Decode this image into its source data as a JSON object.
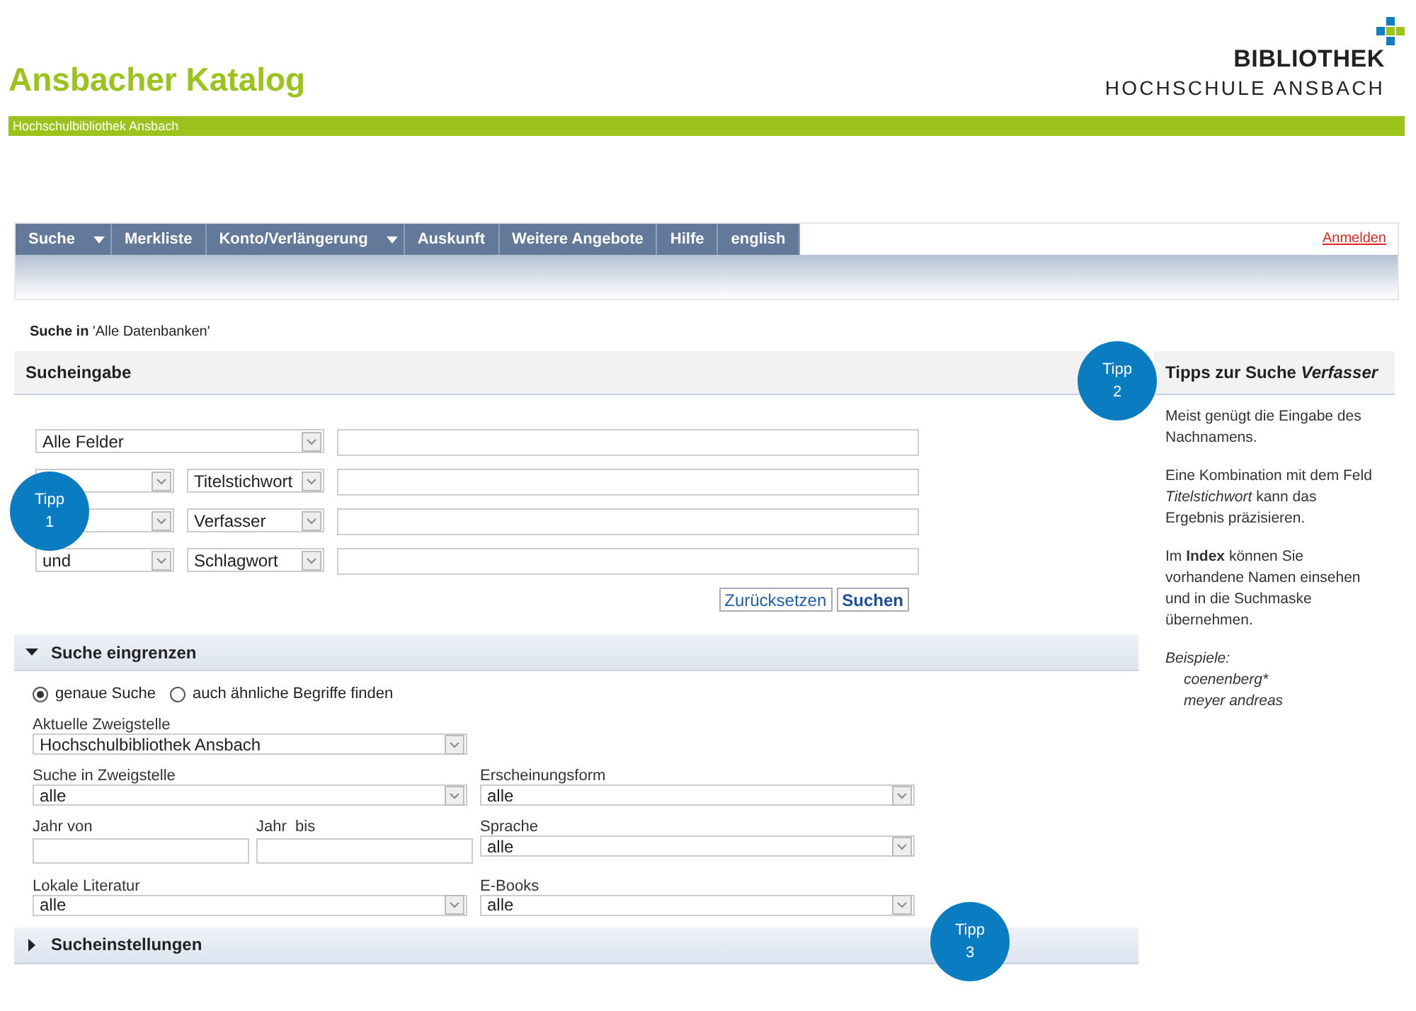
{
  "header": {
    "title": "Ansbacher Katalog",
    "logo_line1": "BIBLIOTHEK",
    "logo_line2": "HOCHSCHULE ANSBACH",
    "banner": "Hochschulbibliothek Ansbach"
  },
  "nav": {
    "items": [
      {
        "label": "Suche",
        "dropdown": true
      },
      {
        "label": "Merkliste",
        "dropdown": false
      },
      {
        "label": "Konto/Verlängerung",
        "dropdown": true
      },
      {
        "label": "Auskunft",
        "dropdown": false
      },
      {
        "label": "Weitere Angebote",
        "dropdown": false
      },
      {
        "label": "Hilfe",
        "dropdown": false
      },
      {
        "label": "english",
        "dropdown": false
      }
    ],
    "login": "Anmelden"
  },
  "scope": {
    "label": "Suche in",
    "value": "'Alle Datenbanken'"
  },
  "search": {
    "title": "Sucheingabe",
    "rows": [
      {
        "field": "Alle Felder"
      },
      {
        "operator": "",
        "field": "Titelstichwort"
      },
      {
        "operator": "",
        "field": "Verfasser"
      },
      {
        "operator": "und",
        "field": "Schlagwort"
      }
    ],
    "buttons": [
      {
        "label": "Zurücksetzen",
        "primary": false
      },
      {
        "label": "Suchen",
        "primary": true
      }
    ]
  },
  "refine": {
    "title": "Suche eingrenzen",
    "expanded": true,
    "radios": [
      {
        "label": "genaue Suche",
        "selected": true
      },
      {
        "label": "auch ähnliche Begriffe finden",
        "selected": false
      }
    ],
    "branch": {
      "label": "Aktuelle Zweigstelle",
      "value": "Hochschulbibliothek Ansbach"
    },
    "fields": [
      {
        "kind": "select",
        "label": "Suche in Zweigstelle",
        "value": "alle"
      },
      {
        "kind": "select",
        "label": "Erscheinungsform",
        "value": "alle"
      },
      {
        "kind": "years",
        "label": "Jahr von",
        "label2": "Jahr  bis"
      },
      {
        "kind": "select",
        "label": "Sprache",
        "value": "alle"
      },
      {
        "kind": "select",
        "label": "Lokale Literatur",
        "value": "alle"
      },
      {
        "kind": "select",
        "label": "E-Books",
        "value": "alle"
      }
    ]
  },
  "settings": {
    "title": "Sucheinstellungen",
    "expanded": false
  },
  "sidebar": {
    "title": "Tipps zur Suche *Verfasser*",
    "paragraphs": [
      "Meist genügt die Eingabe des Nachnamens.",
      "Eine Kombination mit dem Feld *Titelstichwort* kann das Ergebnis präzisieren.",
      "Im **Index** können Sie vorhandene Namen einsehen und in die Suchmaske übernehmen."
    ],
    "examples_label": "Beispiele:",
    "examples": [
      "coenenberg*",
      "meyer andreas"
    ]
  },
  "tips": [
    {
      "label": "Tipp",
      "number": "1"
    },
    {
      "label": "Tipp",
      "number": "2"
    },
    {
      "label": "Tipp",
      "number": "3"
    }
  ]
}
